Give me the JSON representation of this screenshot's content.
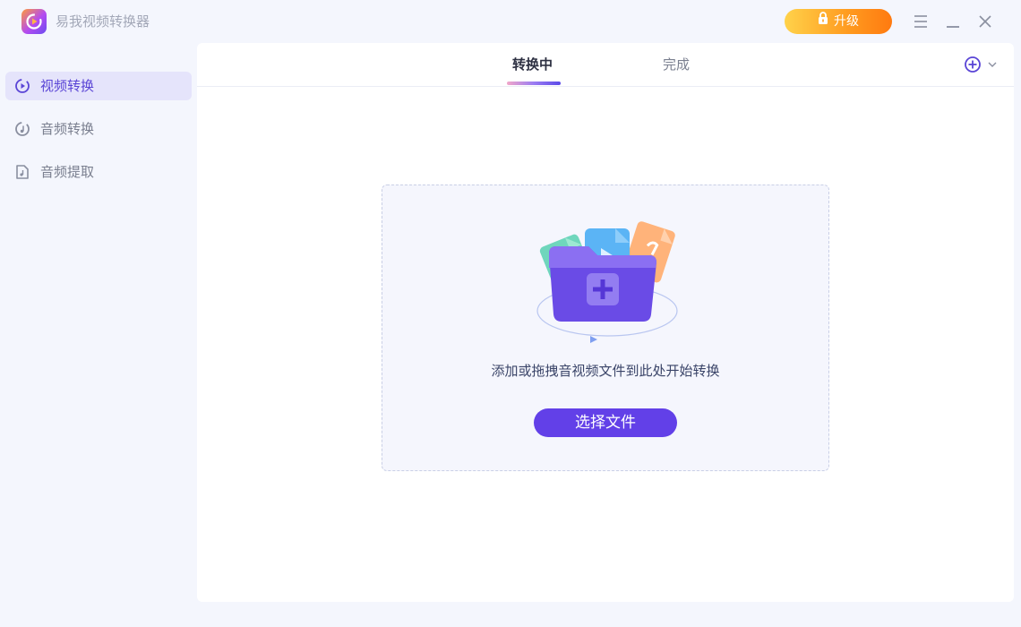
{
  "app": {
    "title": "易我视频转换器",
    "upgrade_label": "升级"
  },
  "sidebar": {
    "items": [
      {
        "label": "视频转换",
        "icon": "video-convert-icon",
        "active": true
      },
      {
        "label": "音频转换",
        "icon": "audio-convert-icon",
        "active": false
      },
      {
        "label": "音频提取",
        "icon": "audio-extract-icon",
        "active": false
      }
    ]
  },
  "tabs": [
    {
      "label": "转换中",
      "active": true
    },
    {
      "label": "完成",
      "active": false
    }
  ],
  "dropzone": {
    "hint": "添加或拖拽音视频文件到此处开始转换",
    "button_label": "选择文件"
  },
  "colors": {
    "accent": "#6240e8",
    "active_text": "#5a45d6",
    "upgrade_start": "#ffd24a",
    "upgrade_end": "#ff7a10"
  }
}
